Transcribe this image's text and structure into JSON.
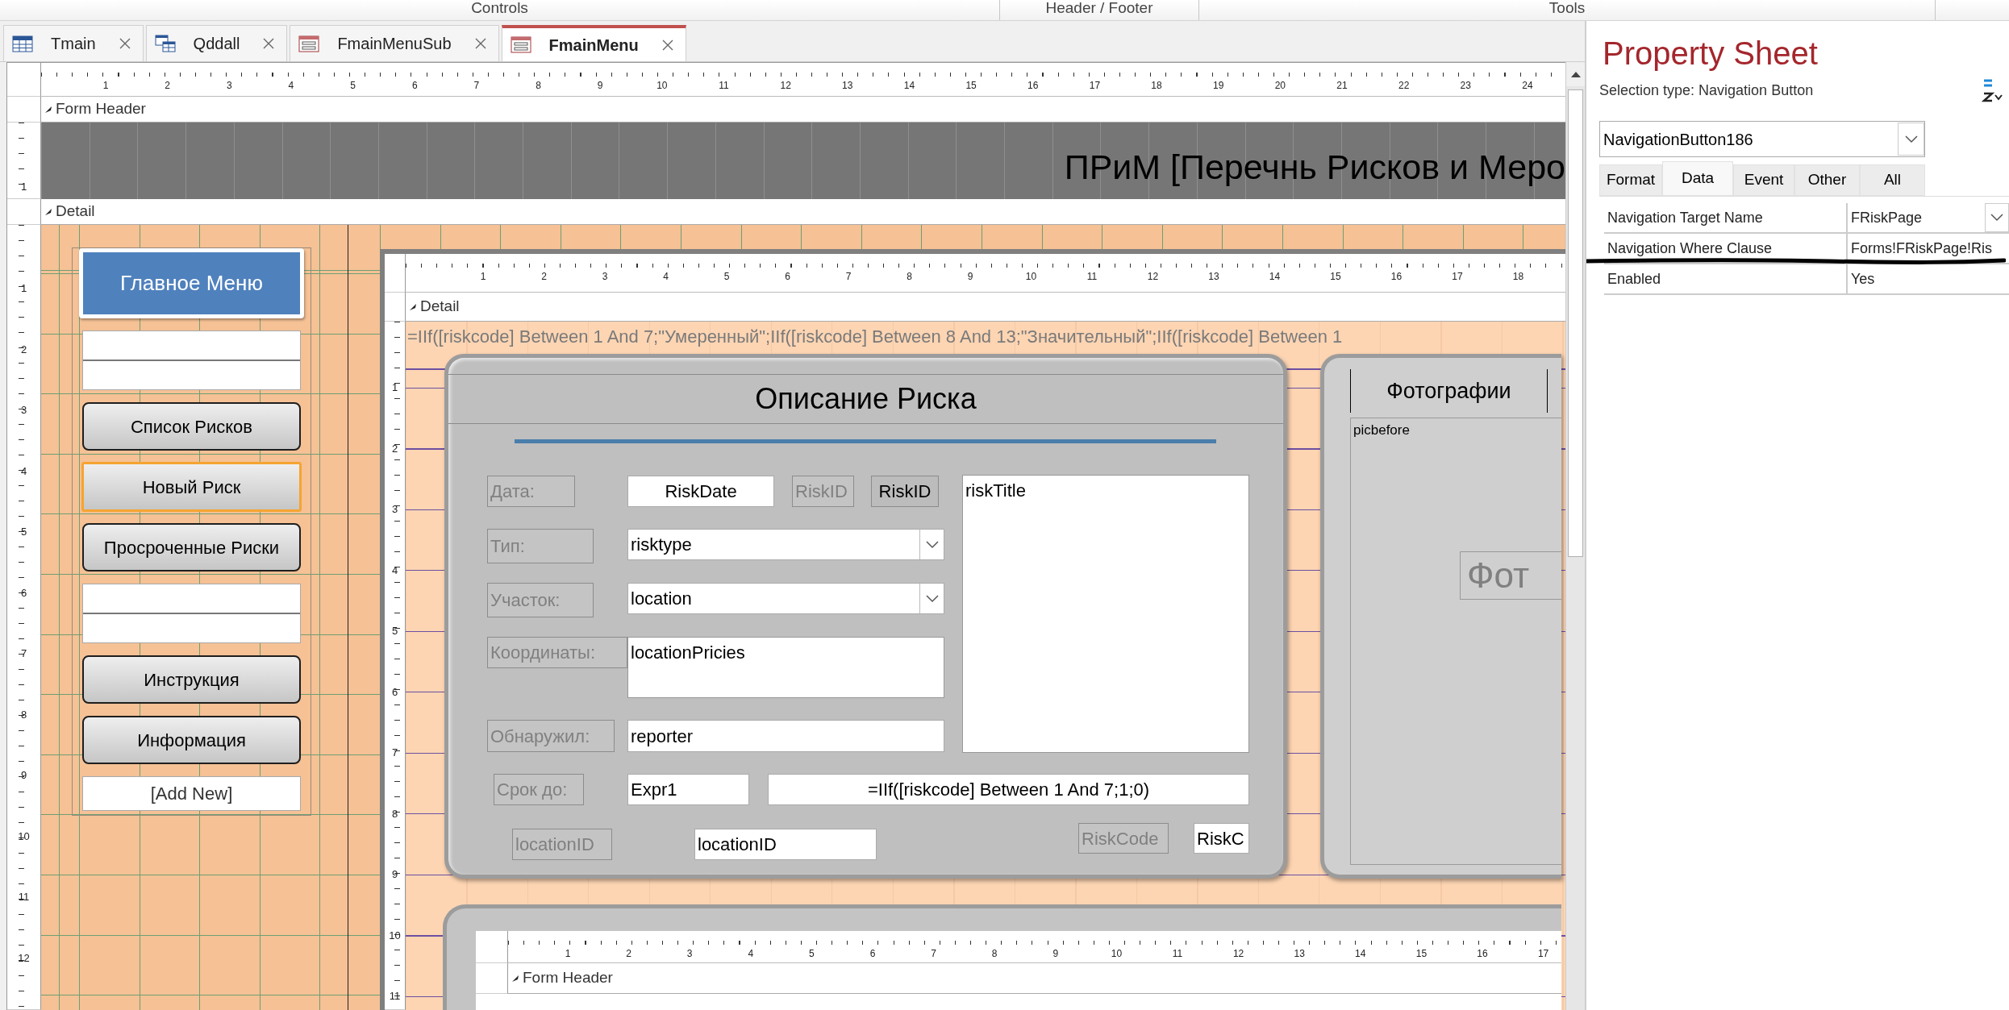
{
  "ribbon_groups": [
    "Controls",
    "Header / Footer",
    "Tools"
  ],
  "document_tabs": [
    {
      "label": "Tmain",
      "kind": "table",
      "selected": false
    },
    {
      "label": "Qddall",
      "kind": "query",
      "selected": false
    },
    {
      "label": "FmainMenuSub",
      "kind": "form",
      "selected": false
    },
    {
      "label": "FmainMenu",
      "kind": "form",
      "selected": true
    }
  ],
  "designer": {
    "ruler_marks": [
      "1",
      "2",
      "3",
      "4",
      "5",
      "6",
      "7",
      "8",
      "9",
      "10",
      "11",
      "12",
      "13",
      "14",
      "15",
      "16",
      "17",
      "18",
      "19",
      "20",
      "21",
      "22",
      "23",
      "24"
    ],
    "form_header": {
      "label": "Form Header",
      "title": "ПРиМ [Перечнь Рисков и Меро",
      "vruler_marks": [
        "1"
      ]
    },
    "detail": {
      "label": "Detail",
      "vruler_marks": [
        "1",
        "2",
        "3",
        "4",
        "5",
        "6",
        "7",
        "8",
        "9",
        "10",
        "11",
        "12"
      ]
    },
    "menu": {
      "header": "Главное Меню",
      "items": [
        {
          "kind": "blank",
          "selected": false
        },
        {
          "kind": "button",
          "label": "Список Рисков",
          "selected": false
        },
        {
          "kind": "button",
          "label": "Новый Риск",
          "selected": true
        },
        {
          "kind": "button",
          "label": "Просроченные Риски",
          "selected": false
        },
        {
          "kind": "blank",
          "selected": false
        },
        {
          "kind": "button",
          "label": "Инструкция",
          "selected": false
        },
        {
          "kind": "button",
          "label": "Информация",
          "selected": false
        },
        {
          "kind": "add",
          "label": "[Add New]",
          "selected": false
        }
      ]
    },
    "subform": {
      "ruler_marks": [
        "1",
        "2",
        "3",
        "4",
        "5",
        "6",
        "7",
        "8",
        "9",
        "10",
        "11",
        "12",
        "13",
        "14",
        "15",
        "16",
        "17",
        "18"
      ],
      "vruler_marks": [
        "1",
        "2",
        "3",
        "4",
        "5",
        "6",
        "7",
        "8",
        "9",
        "10",
        "11"
      ],
      "detail_label": "Detail",
      "expression": "=IIf([riskcode] Between 1 And 7;\"Умеренный\";IIf([riskcode] Between 8 And 13;\"Значительный\";IIf([riskcode] Between 1",
      "risk_card": {
        "title": "Описание Риска",
        "controls": [
          {
            "kind": "label",
            "text": "Дата:"
          },
          {
            "kind": "textbox",
            "text": "RiskDate"
          },
          {
            "kind": "label",
            "text": "RiskID"
          },
          {
            "kind": "caption",
            "text": "RiskID"
          },
          {
            "kind": "memo",
            "text": "riskTitle"
          },
          {
            "kind": "label",
            "text": "Тип:"
          },
          {
            "kind": "combo",
            "text": "risktype"
          },
          {
            "kind": "label",
            "text": "Участок:"
          },
          {
            "kind": "combo",
            "text": "location"
          },
          {
            "kind": "label",
            "text": "Координаты:"
          },
          {
            "kind": "memo",
            "text": "locationPricies"
          },
          {
            "kind": "label",
            "text": "Обнаружил:"
          },
          {
            "kind": "textbox",
            "text": "reporter"
          },
          {
            "kind": "label",
            "text": "Срок до:"
          },
          {
            "kind": "textbox",
            "text": "Expr1"
          },
          {
            "kind": "textbox",
            "text": "=IIf([riskcode] Between 1 And 7;1;0)"
          },
          {
            "kind": "label",
            "text": "locationID"
          },
          {
            "kind": "textbox",
            "text": "locationID"
          },
          {
            "kind": "label",
            "text": "RiskCode"
          },
          {
            "kind": "textbox",
            "text": "RiskC"
          }
        ]
      },
      "photo_card": {
        "tab": "Фотографии",
        "picture_label": "picbefore",
        "button": "Фот"
      },
      "nested_form": {
        "ruler_marks": [
          "1",
          "2",
          "3",
          "4",
          "5",
          "6",
          "7",
          "8",
          "9",
          "10",
          "11",
          "12",
          "13",
          "14",
          "15",
          "16",
          "17"
        ],
        "header_label": "Form Header"
      }
    }
  },
  "property_sheet": {
    "title": "Property Sheet",
    "selection_type": "Selection type:  Navigation Button",
    "object": "NavigationButton186",
    "tabs": [
      {
        "label": "Format",
        "selected": false
      },
      {
        "label": "Data",
        "selected": true
      },
      {
        "label": "Event",
        "selected": false
      },
      {
        "label": "Other",
        "selected": false
      },
      {
        "label": "All",
        "selected": false
      }
    ],
    "rows": [
      {
        "name": "Navigation Target Name",
        "value": "FRiskPage",
        "kind": "combo"
      },
      {
        "name": "Navigation Where Clause",
        "value": "Forms!FRiskPage!Ris",
        "kind": "text"
      },
      {
        "name": "Enabled",
        "value": "Yes",
        "kind": "text"
      }
    ]
  }
}
